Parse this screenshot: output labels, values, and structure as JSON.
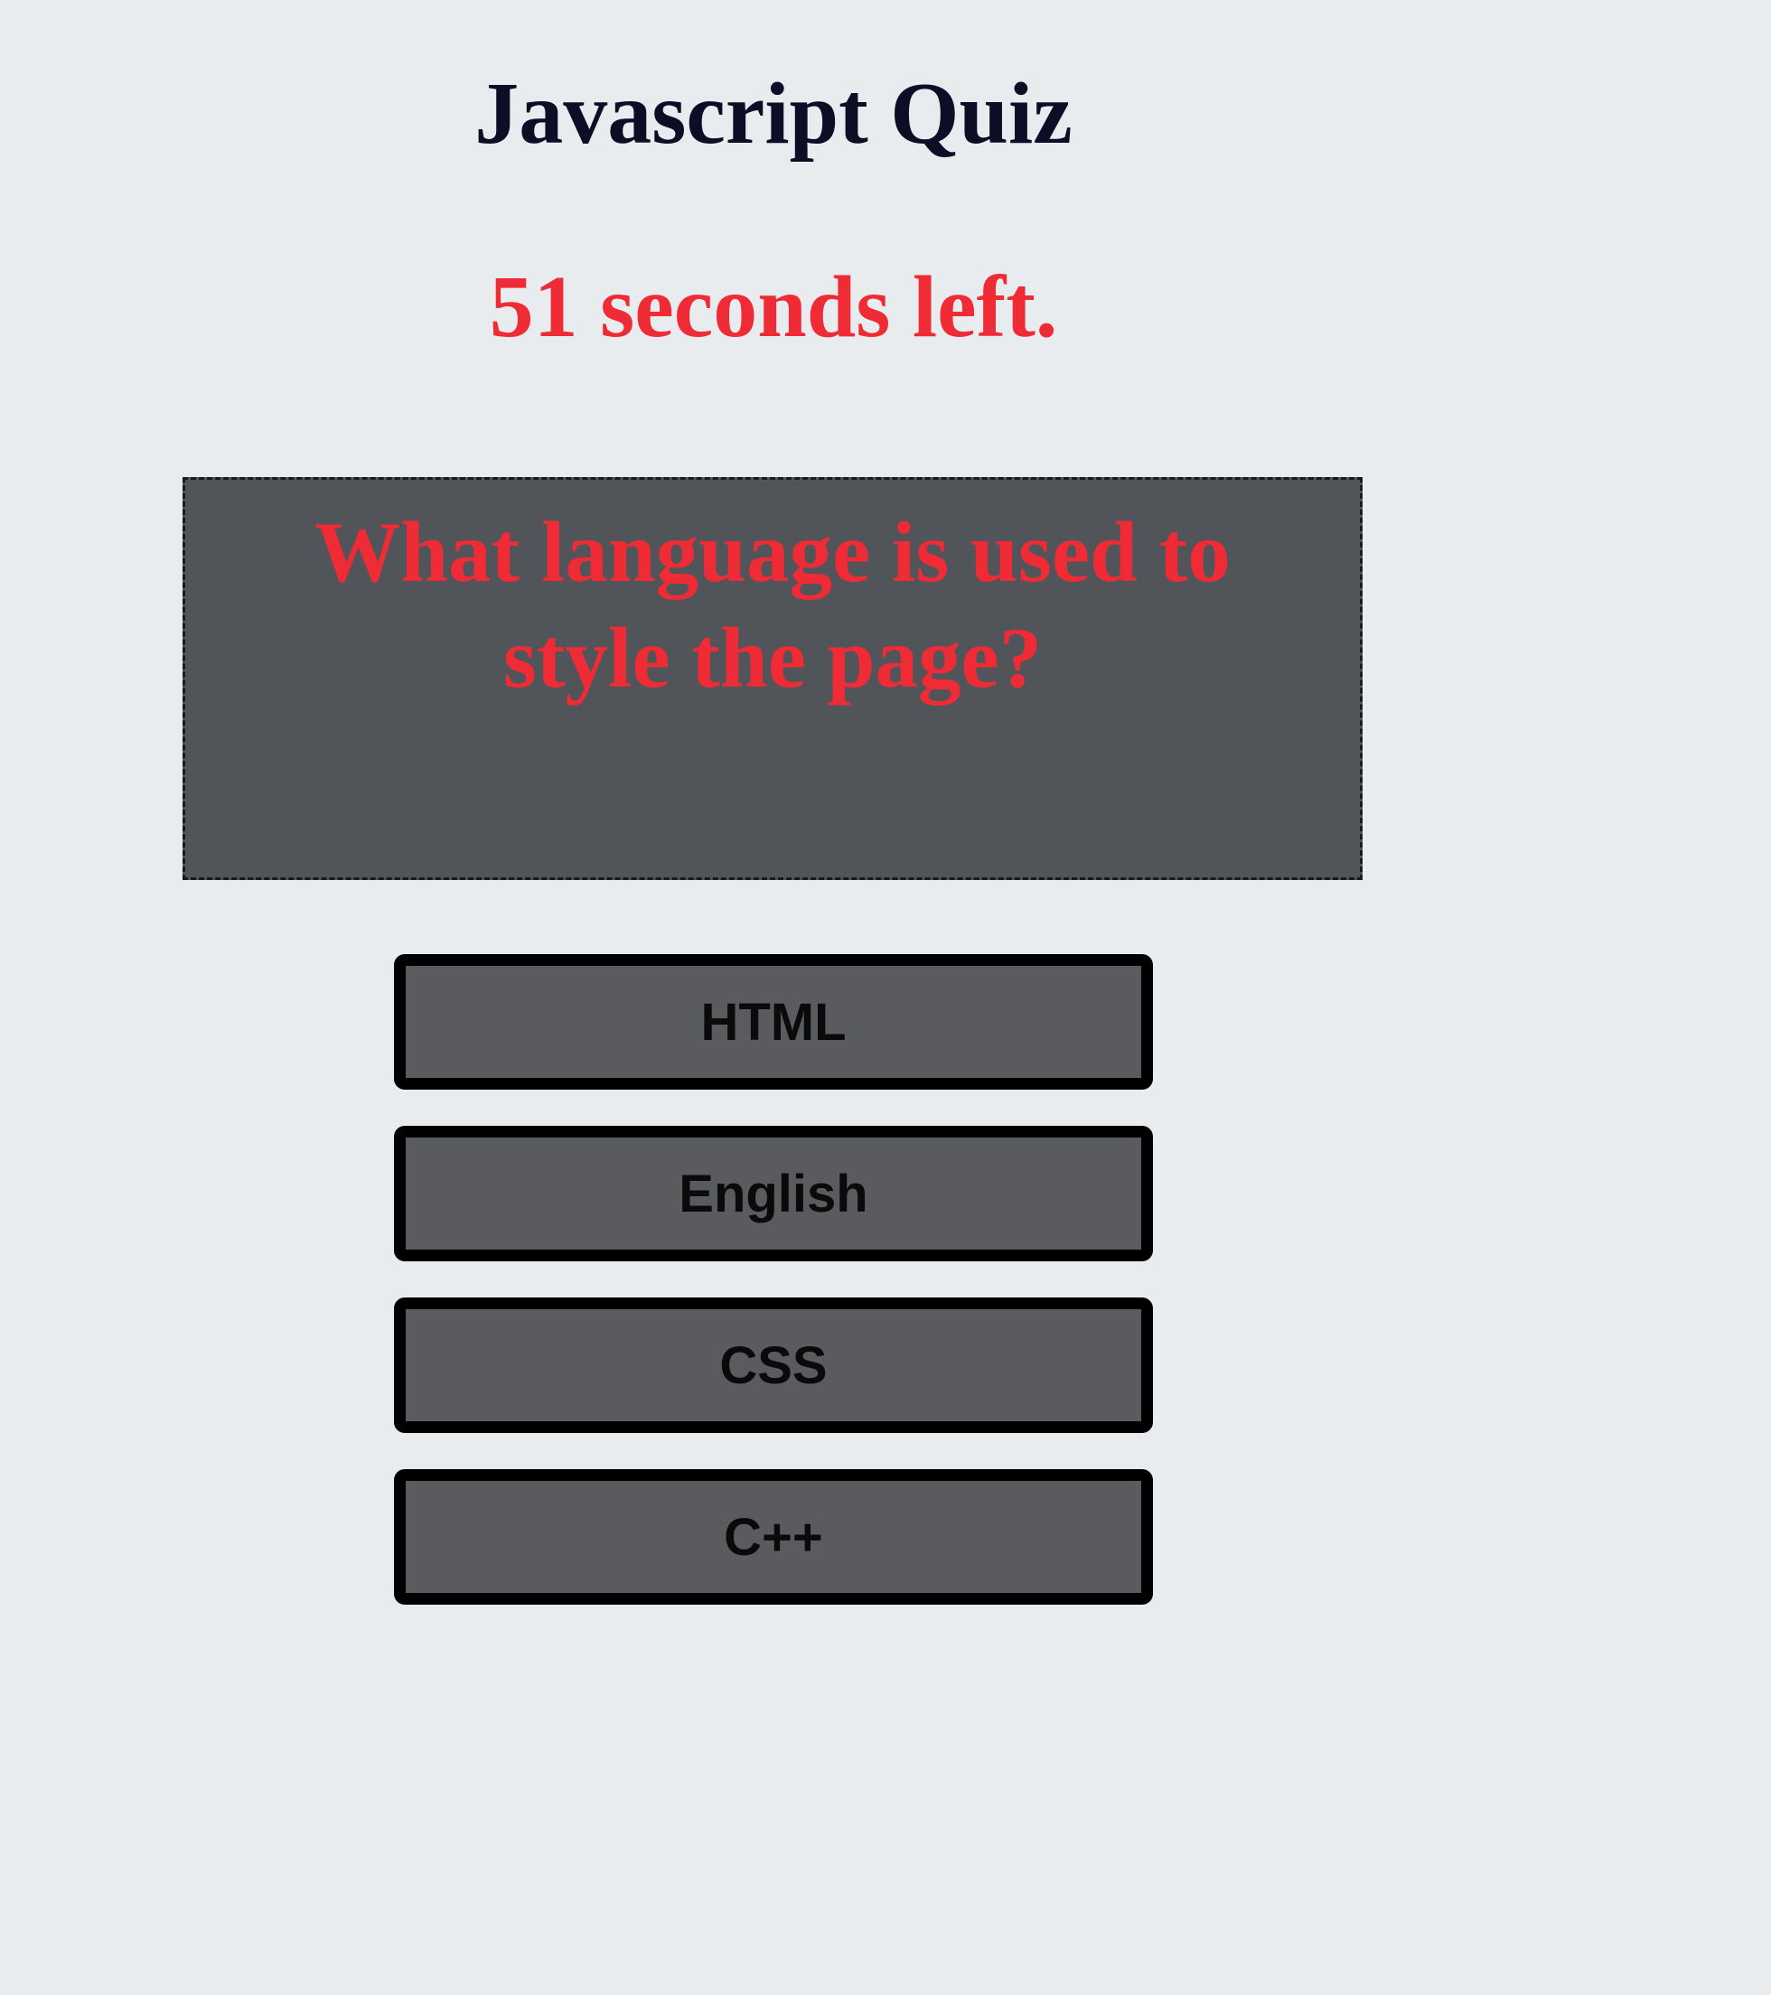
{
  "page": {
    "title": "Javascript Quiz"
  },
  "timer": {
    "text": "51 seconds left."
  },
  "question": {
    "text": "What language is used to style the page?"
  },
  "answers": [
    {
      "label": "HTML"
    },
    {
      "label": "English"
    },
    {
      "label": "CSS"
    },
    {
      "label": "C++"
    }
  ],
  "colors": {
    "background": "#e8ecef",
    "title": "#0d0d26",
    "accent_red": "#ef2b36",
    "question_box": "#515458",
    "answer_button": "#5a5b5f",
    "button_border": "#000000"
  }
}
